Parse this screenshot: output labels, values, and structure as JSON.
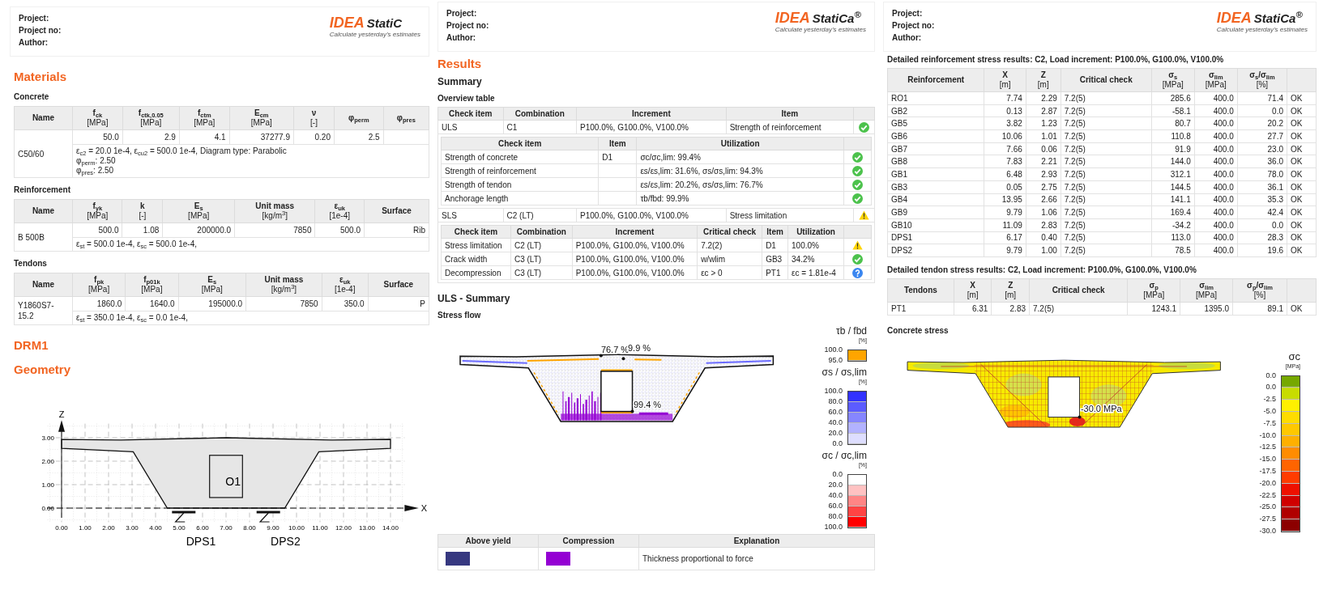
{
  "materials_page": {
    "header": {
      "fields": [
        "Project:",
        "Project no:",
        "Author:"
      ],
      "logo": {
        "mark": "IDEA",
        "text": "StatiC",
        "tagline": "Calculate yesterday's estimates"
      }
    },
    "title": "Materials",
    "concrete": {
      "title": "Concrete",
      "columns": [
        {
          "label": "Name"
        },
        {
          "label": "f$_{ck}$",
          "unit": "[MPa]"
        },
        {
          "label": "f$_{ctk,0.05}$",
          "unit": "[MPa]"
        },
        {
          "label": "f$_{ctm}$",
          "unit": "[MPa]"
        },
        {
          "label": "E$_{cm}$",
          "unit": "[MPa]"
        },
        {
          "label": "ν",
          "unit": "[-]"
        },
        {
          "label": "φ$_{perm}$"
        },
        {
          "label": "φ$_{pres}$"
        }
      ],
      "rows": [
        {
          "name": "C50/60",
          "values": [
            "50.0",
            "2.9",
            "4.1",
            "37277.9",
            "0.20",
            "2.5"
          ],
          "notes": [
            "ε$_{c2}$ = 20.0 1e-4, ε$_{cu2}$ = 500.0 1e-4, Diagram type: Parabolic",
            "φ$_{perm}$: 2.50",
            "φ$_{pres}$: 2.50"
          ]
        }
      ]
    },
    "reinforcement": {
      "title": "Reinforcement",
      "columns": [
        {
          "label": "Name"
        },
        {
          "label": "f$_{yk}$",
          "unit": "[MPa]"
        },
        {
          "label": "k",
          "unit": "[-]"
        },
        {
          "label": "E$_{s}$",
          "unit": "[MPa]"
        },
        {
          "label": "Unit mass",
          "unit": "[kg/m$^{3}$]"
        },
        {
          "label": "ε$_{uk}$",
          "unit": "[1e-4]"
        },
        {
          "label": "Surface"
        }
      ],
      "rows": [
        {
          "name": "B 500B",
          "values": [
            "500.0",
            "1.08",
            "200000.0",
            "7850",
            "500.0",
            "Rib"
          ],
          "notes": [
            "ε$_{st}$ = 500.0 1e-4, ε$_{sc}$ = 500.0 1e-4,"
          ]
        }
      ]
    },
    "tendons": {
      "title": "Tendons",
      "columns": [
        {
          "label": "Name"
        },
        {
          "label": "f$_{pk}$",
          "unit": "[MPa]"
        },
        {
          "label": "f$_{p01k}$",
          "unit": "[MPa]"
        },
        {
          "label": "E$_{s}$",
          "unit": "[MPa]"
        },
        {
          "label": "Unit mass",
          "unit": "[kg/m$^{3}$]"
        },
        {
          "label": "ε$_{uk}$",
          "unit": "[1e-4]"
        },
        {
          "label": "Surface"
        }
      ],
      "rows": [
        {
          "name": "Y1860S7-15.2",
          "values": [
            "1860.0",
            "1640.0",
            "195000.0",
            "7850",
            "350.0",
            "P"
          ],
          "notes": [
            "ε$_{st}$ = 350.0 1e-4, ε$_{sc}$ = 0.0 1e-4,"
          ]
        }
      ]
    },
    "section_title": "DRM1",
    "geometry": {
      "title": "Geometry",
      "z_label": "Z",
      "x_label": "X",
      "z_ticks": [
        "3.00",
        "2.00",
        "1.00",
        "0.00"
      ],
      "x_ticks": [
        "0.00",
        "1.00",
        "2.00",
        "3.00",
        "4.00",
        "5.00",
        "6.00",
        "7.00",
        "8.00",
        "9.00",
        "10.00",
        "11.00",
        "12.00",
        "13.00",
        "14.00"
      ],
      "opening": "O1",
      "supports": [
        "DPS1",
        "DPS2"
      ]
    }
  },
  "results_page": {
    "header": {
      "fields": [
        "Project:",
        "Project no:",
        "Author:"
      ],
      "logo": {
        "mark": "IDEA",
        "text": "StatiCa$^{®}$",
        "tagline": "Calculate yesterday's estimates"
      }
    },
    "title": "Results",
    "summary_title": "Summary",
    "overview_title": "Overview table",
    "overview": {
      "columns": [
        "Check item",
        "Combination",
        "Increment",
        "Item"
      ],
      "groups": [
        {
          "cells": [
            "ULS",
            "C1",
            "P100.0%, G100.0%, V100.0%",
            "Strength of reinforcement"
          ],
          "kind": "ok",
          "sub": {
            "columns": [
              "Check item",
              "Item",
              "Utilization"
            ],
            "rows": [
              {
                "cells": [
                  "Strength of concrete",
                  "D1",
                  "σc/σc,lim: 99.4%"
                ],
                "kind": "ok"
              },
              {
                "cells": [
                  "Strength of reinforcement",
                  "",
                  "εs/εs,lim: 31.6%, σs/σs,lim: 94.3%"
                ],
                "kind": "ok"
              },
              {
                "cells": [
                  "Strength of tendon",
                  "",
                  "εs/εs,lim: 20.2%, σs/σs,lim: 76.7%"
                ],
                "kind": "ok"
              },
              {
                "cells": [
                  "Anchorage length",
                  "",
                  "τb/fbd: 99.9%"
                ],
                "kind": "ok"
              }
            ]
          }
        },
        {
          "cells": [
            "SLS",
            "C2 (LT)",
            "P100.0%, G100.0%, V100.0%",
            "Stress limitation"
          ],
          "kind": "warning",
          "sub": {
            "columns": [
              "Check item",
              "Combination",
              "Increment",
              "Critical check",
              "Item",
              "Utilization"
            ],
            "rows": [
              {
                "cells": [
                  "Stress limitation",
                  "C2 (LT)",
                  "P100.0%, G100.0%, V100.0%",
                  "7.2(2)",
                  "D1",
                  "100.0%"
                ],
                "kind": "warning"
              },
              {
                "cells": [
                  "Crack width",
                  "C3 (LT)",
                  "P100.0%, G100.0%, V100.0%",
                  "w/wlim",
                  "GB3",
                  "34.2%"
                ],
                "kind": "ok"
              },
              {
                "cells": [
                  "Decompression",
                  "C3 (LT)",
                  "P100.0%, G100.0%, V100.0%",
                  "εc > 0",
                  "PT1",
                  "εc = 1.81e-4"
                ],
                "kind": "info"
              }
            ]
          }
        }
      ]
    },
    "uls_title": "ULS - Summary",
    "flow_title": "Stress flow",
    "flow_labels": [
      "76.7 %",
      "9.9 %",
      "99.4 %"
    ],
    "legends": [
      {
        "title": "τb / fbd",
        "unit": "[%]",
        "labels": [
          "100.0",
          "95.0"
        ],
        "bands": [
          {
            "color": "#ffa500"
          }
        ]
      },
      {
        "title": "σs / σs,lim",
        "unit": "[%]",
        "labels": [
          "100.0",
          "80.0",
          "60.0",
          "40.0",
          "20.0",
          "0.0"
        ],
        "bands": [
          {
            "color": "#3232ff"
          },
          {
            "color": "#5c5cff"
          },
          {
            "color": "#8686ff"
          },
          {
            "color": "#b2b2ff"
          },
          {
            "color": "#dedeff"
          }
        ]
      },
      {
        "title": "σc / σc,lim",
        "unit": "[%]",
        "labels": [
          "0.0",
          "20.0",
          "40.0",
          "60.0",
          "80.0",
          "100.0"
        ],
        "bands": [
          {
            "color": "#ffffff"
          },
          {
            "color": "#ffc2c2"
          },
          {
            "color": "#ff8585"
          },
          {
            "color": "#ff4343"
          },
          {
            "color": "#ff0000"
          }
        ]
      }
    ],
    "key_table": {
      "columns": [
        "Above yield",
        "Compression",
        "Explanation"
      ],
      "swatches": [
        {
          "color": "#363880"
        },
        {
          "color": "#9400d3"
        }
      ],
      "explanation": "Thickness proportional to force"
    }
  },
  "details_page": {
    "header": {
      "fields": [
        "Project:",
        "Project no:",
        "Author:"
      ],
      "logo": {
        "mark": "IDEA",
        "text": "StatiCa$^{®}$",
        "tagline": "Calculate yesterday's estimates"
      }
    },
    "reinforcement_results": {
      "title": "Detailed reinforcement stress results: C2, Load increment: P100.0%, G100.0%, V100.0%",
      "columns": [
        {
          "label": "Reinforcement"
        },
        {
          "label": "X",
          "unit": "[m]"
        },
        {
          "label": "Z",
          "unit": "[m]"
        },
        {
          "label": "Critical check"
        },
        {
          "label": "σ$_{s}$",
          "unit": "[MPa]"
        },
        {
          "label": "σ$_{lim}$",
          "unit": "[MPa]"
        },
        {
          "label": "σ$_{s}$/σ$_{lim}$",
          "unit": "[%]"
        },
        {}
      ],
      "rows": [
        [
          "RO1",
          "7.74",
          "2.29",
          "7.2(5)",
          "285.6",
          "400.0",
          "71.4",
          "OK"
        ],
        [
          "GB2",
          "0.13",
          "2.87",
          "7.2(5)",
          "-58.1",
          "400.0",
          "0.0",
          "OK"
        ],
        [
          "GB5",
          "3.82",
          "1.23",
          "7.2(5)",
          "80.7",
          "400.0",
          "20.2",
          "OK"
        ],
        [
          "GB6",
          "10.06",
          "1.01",
          "7.2(5)",
          "110.8",
          "400.0",
          "27.7",
          "OK"
        ],
        [
          "GB7",
          "7.66",
          "0.06",
          "7.2(5)",
          "91.9",
          "400.0",
          "23.0",
          "OK"
        ],
        [
          "GB8",
          "7.83",
          "2.21",
          "7.2(5)",
          "144.0",
          "400.0",
          "36.0",
          "OK"
        ],
        [
          "GB1",
          "6.48",
          "2.93",
          "7.2(5)",
          "312.1",
          "400.0",
          "78.0",
          "OK"
        ],
        [
          "GB3",
          "0.05",
          "2.75",
          "7.2(5)",
          "144.5",
          "400.0",
          "36.1",
          "OK"
        ],
        [
          "GB4",
          "13.95",
          "2.66",
          "7.2(5)",
          "141.1",
          "400.0",
          "35.3",
          "OK"
        ],
        [
          "GB9",
          "9.79",
          "1.06",
          "7.2(5)",
          "169.4",
          "400.0",
          "42.4",
          "OK"
        ],
        [
          "GB10",
          "11.09",
          "2.83",
          "7.2(5)",
          "-34.2",
          "400.0",
          "0.0",
          "OK"
        ],
        [
          "DPS1",
          "6.17",
          "0.40",
          "7.2(5)",
          "113.0",
          "400.0",
          "28.3",
          "OK"
        ],
        [
          "DPS2",
          "9.79",
          "1.00",
          "7.2(5)",
          "78.5",
          "400.0",
          "19.6",
          "OK"
        ]
      ]
    },
    "tendon_results": {
      "title": "Detailed tendon stress results: C2, Load increment: P100.0%, G100.0%, V100.0%",
      "columns": [
        {
          "label": "Tendons"
        },
        {
          "label": "X",
          "unit": "[m]"
        },
        {
          "label": "Z",
          "unit": "[m]"
        },
        {
          "label": "Critical check"
        },
        {
          "label": "σ$_{p}$",
          "unit": "[MPa]"
        },
        {
          "label": "σ$_{lim}$",
          "unit": "[MPa]"
        },
        {
          "label": "σ$_{p}$/σ$_{lim}$",
          "unit": "[%]"
        },
        {}
      ],
      "rows": [
        [
          "PT1",
          "6.31",
          "2.83",
          "7.2(5)",
          "1243.1",
          "1395.0",
          "89.1",
          "OK"
        ]
      ]
    },
    "concrete_stress": {
      "title": "Concrete stress",
      "label": "-30.0 MPa",
      "legend": {
        "title": "σc",
        "unit": "[MPa]",
        "labels": [
          "0.0",
          "0.0",
          "-2.5",
          "-5.0",
          "-7.5",
          "-10.0",
          "-12.5",
          "-15.0",
          "-17.5",
          "-20.0",
          "-22.5",
          "-25.0",
          "-27.5",
          "-30.0"
        ],
        "bands": [
          {
            "color": "#76a800"
          },
          {
            "color": "#c8dc00"
          },
          {
            "color": "#fff000"
          },
          {
            "color": "#ffdc00"
          },
          {
            "color": "#ffc800"
          },
          {
            "color": "#ffb000"
          },
          {
            "color": "#ff8c00"
          },
          {
            "color": "#ff6400"
          },
          {
            "color": "#ff3c00"
          },
          {
            "color": "#ee1000"
          },
          {
            "color": "#d00000"
          },
          {
            "color": "#b00000"
          },
          {
            "color": "#8c0000"
          }
        ]
      }
    }
  }
}
